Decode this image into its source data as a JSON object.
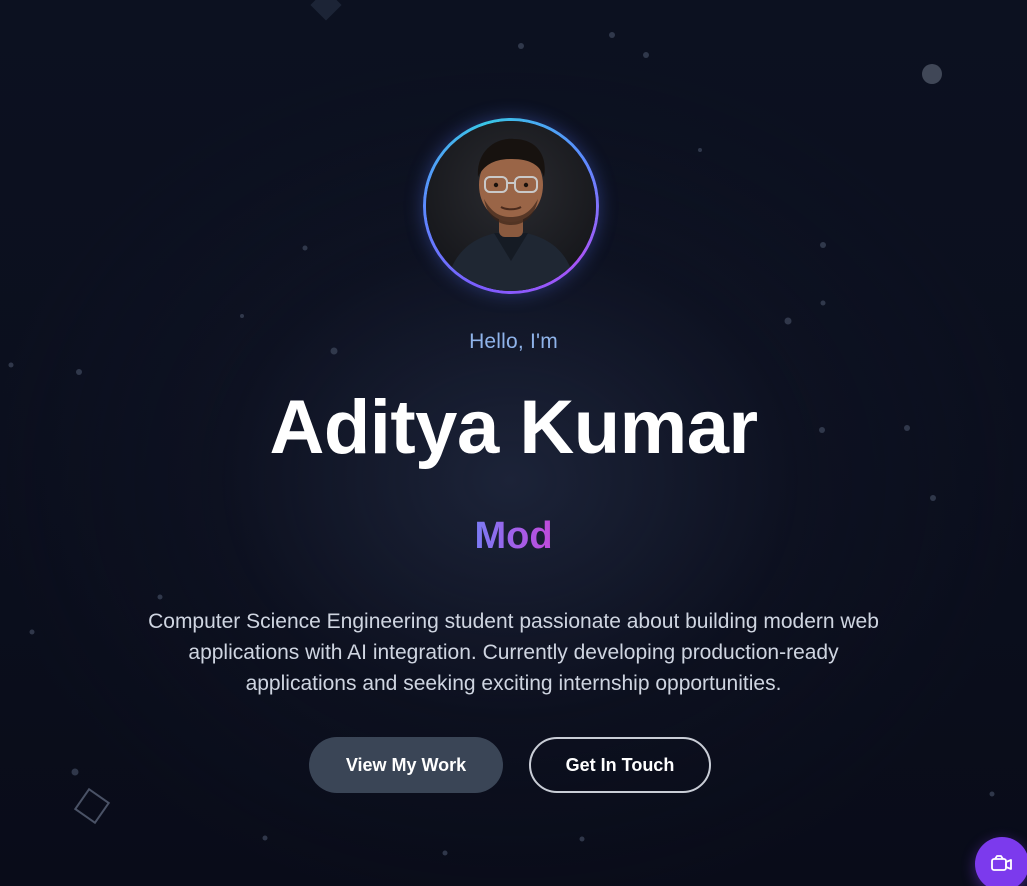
{
  "hero": {
    "greeting": "Hello, I'm",
    "name": "Aditya Kumar",
    "role_text": "Mod",
    "bio_lines": [
      "Computer Science Engineering student passionate about building modern web",
      "applications with AI integration. Currently developing production-ready",
      "applications and seeking exciting internship opportunities."
    ],
    "primary_button_label": "View My Work",
    "secondary_button_label": "Get In Touch"
  },
  "avatar": {
    "icon": "profile-photo"
  },
  "fab": {
    "icon": "chat-widget-icon"
  },
  "colors": {
    "background": "#0b0f1e",
    "greeting": "#8fb3ea",
    "role_gradient_start": "#7a7cf5",
    "role_gradient_end": "#c04ad9",
    "primary_button": "#3a4556",
    "fab": "#7c3aed",
    "ring_start": "#7c5cff",
    "ring_mid": "#39c6e6"
  }
}
